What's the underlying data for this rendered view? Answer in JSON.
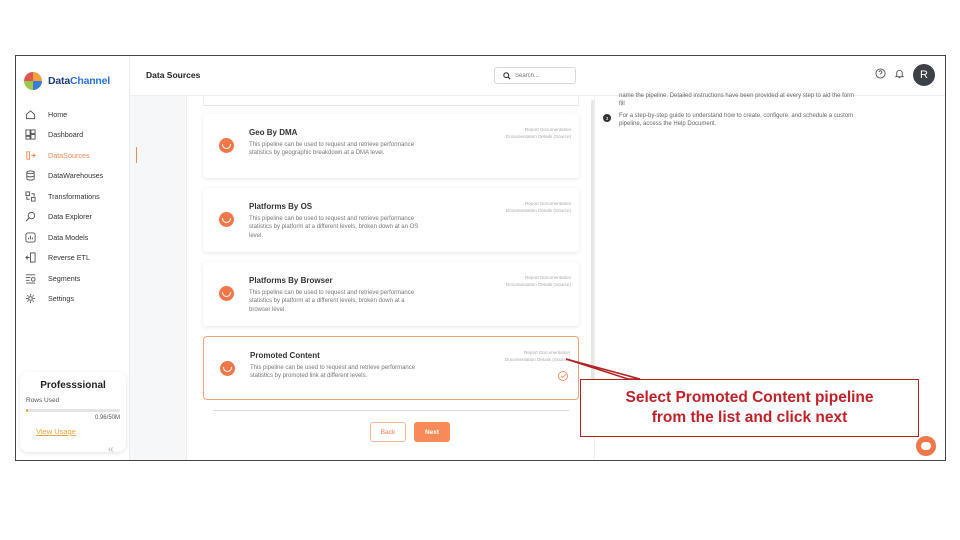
{
  "app": {
    "logo_primary": "Data",
    "logo_accent": "Channel"
  },
  "sidebar": {
    "items": [
      {
        "label": "Home",
        "icon": "home-icon",
        "active": false
      },
      {
        "label": "Dashboard",
        "icon": "dashboard-icon",
        "active": false
      },
      {
        "label": "DataSources",
        "icon": "datasources-icon",
        "active": true
      },
      {
        "label": "DataWarehouses",
        "icon": "database-icon",
        "active": false
      },
      {
        "label": "Transformations",
        "icon": "transform-icon",
        "active": false
      },
      {
        "label": "Data Explorer",
        "icon": "explorer-icon",
        "active": false
      },
      {
        "label": "Data Models",
        "icon": "models-icon",
        "active": false
      },
      {
        "label": "Reverse ETL",
        "icon": "reverse-etl-icon",
        "active": false
      },
      {
        "label": "Segments",
        "icon": "segments-icon",
        "active": false
      },
      {
        "label": "Settings",
        "icon": "settings-icon",
        "active": false
      }
    ],
    "plan": {
      "title": "Professsional",
      "rows_label": "Rows Used",
      "rows_value": "0.96/50M",
      "usage_fraction": 0.02,
      "link": "View Usage"
    },
    "collapse_glyph": "«"
  },
  "header": {
    "title": "Data Sources",
    "search_placeholder": "Search...",
    "avatar_initial": "R"
  },
  "pipelines": [
    {
      "title": "Geo By DMA",
      "description": "This pipeline can be used to request and retrieve performance statistics by geographic breakdown at a DMA level.",
      "link1": "Report Documentation",
      "link2": "Documentation Details (Source)",
      "selected": false
    },
    {
      "title": "Platforms By OS",
      "description": "This pipeline can be used to request and retrieve performance statistics by platform at a different levels, broken down at an OS level.",
      "link1": "Report Documentation",
      "link2": "Documentation Details (Source)",
      "selected": false
    },
    {
      "title": "Platforms By Browser",
      "description": "This pipeline can be used to request and retrieve performance statistics by platform at a different levels, broken down at a browser level.",
      "link1": "Report Documentation",
      "link2": "Documentation Details (Source)",
      "selected": false
    },
    {
      "title": "Promoted Content",
      "description": "This pipeline can be used to request and retrieve performance statistics by promoted link at different levels.",
      "link1": "Report Documentation",
      "link2": "Documentation Details (Source)",
      "selected": true
    }
  ],
  "buttons": {
    "back": "Back",
    "next": "Next"
  },
  "instructions": {
    "partial": "name the pipeline. Detailed instructions have been provided at every step to aid the form fill",
    "step_number": "3",
    "step_text": "For a step-by-step guide to understand how to create, configure, and schedule a custom pipeline, access the Help Document."
  },
  "callout": {
    "line1": "Select Promoted Content pipeline",
    "line2": "from the list and click next"
  },
  "colors": {
    "accent": "#f0774a",
    "callout_red": "#c0222a"
  }
}
